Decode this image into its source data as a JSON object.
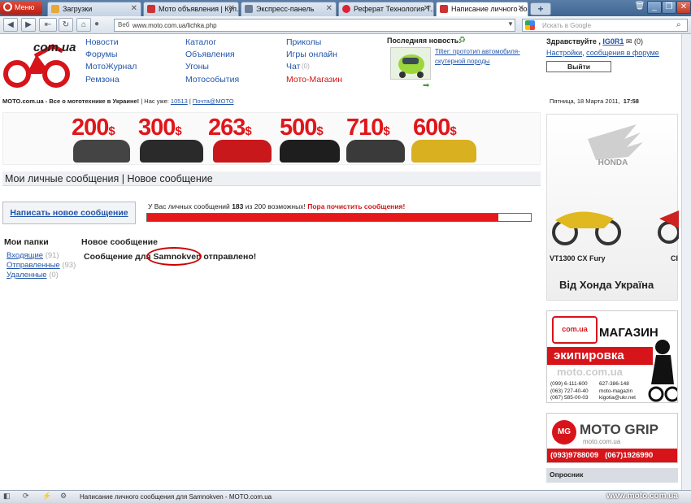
{
  "browser": {
    "menu_label": "Меню",
    "tabs": [
      {
        "label": "Загрузки"
      },
      {
        "label": "Мото объявления | Куп..."
      },
      {
        "label": "Экспресс-панель"
      },
      {
        "label": "Реферат Технология Т..."
      },
      {
        "label": "Написание личного соо..."
      }
    ],
    "address_prefix": "Веб",
    "address": "www.moto.com.ua/lichka.php",
    "search_placeholder": "Искать в Google",
    "status_text": "Написание личного сообщения для Samnokven - MOTO.com.ua",
    "watermark": "www.moto.com.ua"
  },
  "site": {
    "logo_text": "com.ua",
    "nav": {
      "col1": [
        "Новости",
        "Форумы",
        "МотоЖурнал",
        "Ремзона"
      ],
      "col2": [
        "Каталог",
        "Объявления",
        "Угоны",
        "Мотособытия"
      ],
      "col3": [
        "Приколы",
        "Игры онлайн",
        "Чат",
        "Мото-Магазин"
      ],
      "chat_count": "(0)"
    },
    "news": {
      "heading": "Последняя новость:",
      "text": "Tilter: прототип автомобиля-скутерной породы"
    },
    "user": {
      "greeting": "Здравствуйте ,",
      "name": "IG0R1",
      "mail_count": "(0)",
      "settings": "Настройки",
      "forum_messages": "сообщения в форуме",
      "comma": ",",
      "exit": "Выйти"
    },
    "tagline": {
      "prefix": "MOTO.com.ua - Все о мототехнике в Украине!",
      "separator": "|",
      "count_label": "Нас уже:",
      "count": "10513",
      "mail": "Почта@МОТО"
    },
    "date": "Пятница, 18 Марта 2011,",
    "time": "17:58",
    "banner_prices": [
      "200",
      "300",
      "263",
      "500",
      "710",
      "600"
    ],
    "banner_currency": "$",
    "page_title": "Мои личные сообщения | Новое сообщение",
    "write_button": "Написать новое сообщение",
    "msg_count": {
      "prefix": "У Вас личных сообщений",
      "count": "183",
      "middle": "из 200 возможных!",
      "warning": "Пора почистить сообщения!"
    },
    "progress_fraction": 0.915,
    "folders": {
      "title": "Мои папки",
      "items": [
        {
          "label": "Входящие",
          "count": "(91)"
        },
        {
          "label": "Отправленные",
          "count": "(93)"
        },
        {
          "label": "Удаленные",
          "count": "(0)"
        }
      ]
    },
    "new_msg_title": "Новое сообщение",
    "sent": {
      "prefix": "Сообщение для",
      "name": "Samnokven",
      "suffix": "отправлено!"
    },
    "honda_ad": {
      "brand": "HONDA",
      "model": "VT1300 CX Fury",
      "model2": "CI",
      "slogan": "Від Хонда Україна"
    },
    "shop_ad": {
      "logo": "com.ua",
      "title": "МАГАЗИН",
      "subtitle": "экипировка",
      "site": "moto.com.ua",
      "phones": [
        "(099) 6-111-600",
        "(063) 727-40-40",
        "(067) 585-00-03"
      ],
      "phones2": [
        "627-386-148",
        "moto-magazin",
        "kigotia@ukr.net"
      ]
    },
    "motogrip": {
      "badge": "MG",
      "title": "MOTO GRIP",
      "site": "moto.com.ua",
      "phone1": "(093)9788009",
      "phone2": "(067)1926990"
    },
    "poll_title": "Опросник"
  },
  "colors": {
    "accent_red": "#e41a1a",
    "link_blue": "#2255aa"
  }
}
